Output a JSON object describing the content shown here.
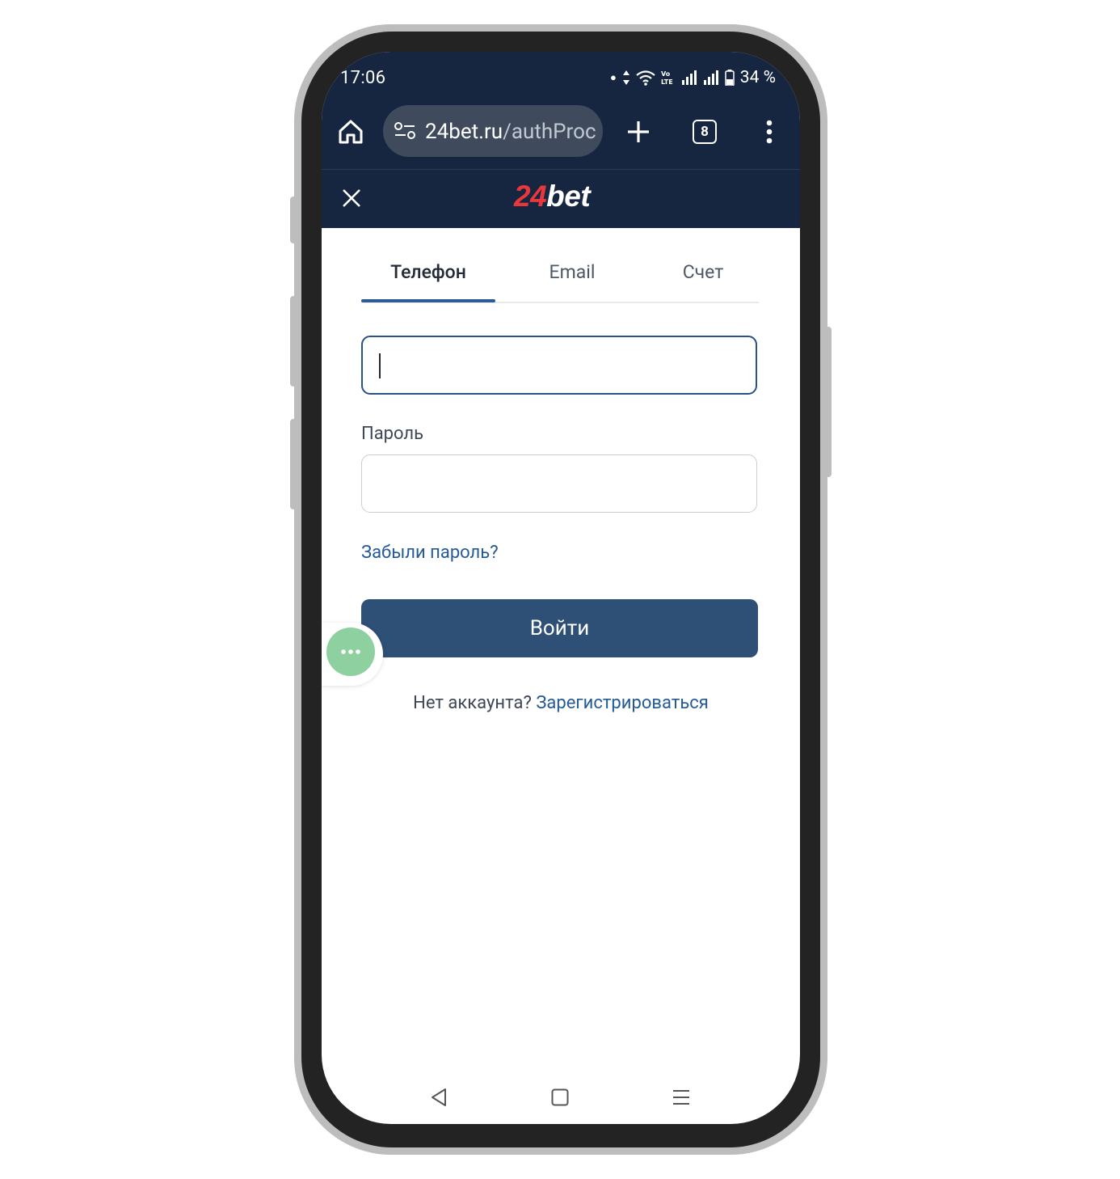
{
  "status_bar": {
    "time": "17:06",
    "battery": "34 %",
    "icons": [
      "dot-icon",
      "data-arrows-icon",
      "wifi-icon",
      "volte-icon",
      "signal-icon",
      "signal-icon",
      "battery-icon"
    ]
  },
  "browser": {
    "url_host": "24bet.ru",
    "url_path": "/authProc",
    "tab_count": "8",
    "icons": [
      "home-icon",
      "site-settings-icon",
      "plus-icon",
      "tabs-icon",
      "more-vert-icon"
    ]
  },
  "header": {
    "logo_number": "24",
    "logo_word": "bet",
    "close_icon": "close-icon"
  },
  "login": {
    "tabs": [
      {
        "label": "Телефон",
        "active": true
      },
      {
        "label": "Email",
        "active": false
      },
      {
        "label": "Счет",
        "active": false
      }
    ],
    "phone_value": "",
    "password_label": "Пароль",
    "password_value": "",
    "forgot_link": "Забыли пароль?",
    "submit_label": "Войти",
    "no_account_text": "Нет аккаунта?",
    "register_link": "Зарегистрироваться"
  },
  "floating_button": {
    "icon": "more-horiz-icon",
    "label": "···"
  },
  "colors": {
    "header_bg": "#172640",
    "accent": "#2e4f76",
    "link": "#255a96",
    "logo_red": "#e8383b",
    "float_green": "#8fd0a1"
  },
  "nav_bar": [
    "back-icon",
    "home-square-icon",
    "recents-icon"
  ]
}
